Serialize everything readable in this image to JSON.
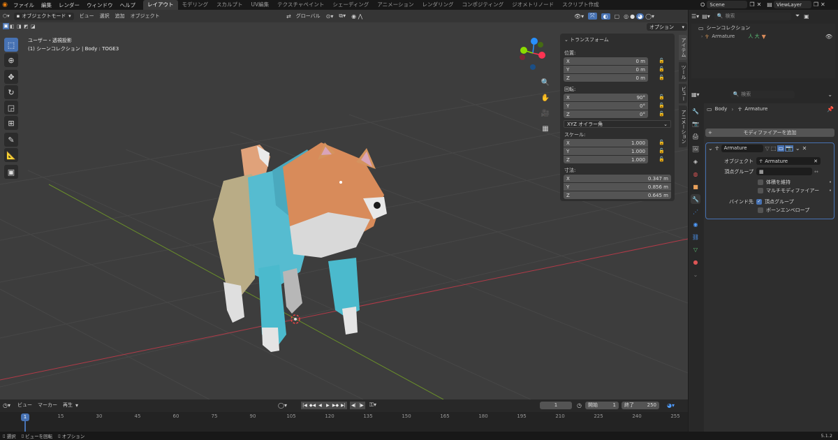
{
  "menu": {
    "items": [
      "ファイル",
      "編集",
      "レンダー",
      "ウィンドウ",
      "ヘルプ"
    ]
  },
  "workspaces": [
    "レイアウト",
    "モデリング",
    "スカルプト",
    "UV編集",
    "テクスチャペイント",
    "シェーディング",
    "アニメーション",
    "レンダリング",
    "コンポジティング",
    "ジオメトリノード",
    "スクリプト作成"
  ],
  "scene": {
    "name": "Scene",
    "viewlayer": "ViewLayer"
  },
  "viewport": {
    "mode": "オブジェクトモード",
    "menus": [
      "ビュー",
      "選択",
      "追加",
      "オブジェクト"
    ],
    "orientation": "グローバル",
    "options": "オプション",
    "view_label": "ユーザー・透視投影",
    "collection_label": "(1) シーンコレクション | Body : TOGE3"
  },
  "npanel": {
    "title": "トランスフォーム",
    "location_label": "位置:",
    "location": [
      {
        "axis": "X",
        "val": "0 m"
      },
      {
        "axis": "Y",
        "val": "0 m"
      },
      {
        "axis": "Z",
        "val": "0 m"
      }
    ],
    "rotation_label": "回転:",
    "rotation": [
      {
        "axis": "X",
        "val": "90°"
      },
      {
        "axis": "Y",
        "val": "0°"
      },
      {
        "axis": "Z",
        "val": "0°"
      }
    ],
    "rotation_mode": "XYZ オイラー角",
    "scale_label": "スケール:",
    "scale": [
      {
        "axis": "X",
        "val": "1.000"
      },
      {
        "axis": "Y",
        "val": "1.000"
      },
      {
        "axis": "Z",
        "val": "1.000"
      }
    ],
    "dim_label": "寸法:",
    "dimensions": [
      {
        "axis": "X",
        "val": "0.347 m"
      },
      {
        "axis": "Y",
        "val": "0.856 m"
      },
      {
        "axis": "Z",
        "val": "0.645 m"
      }
    ],
    "tabs": [
      "アイテム",
      "ツール",
      "ビュー",
      "アニメーション"
    ]
  },
  "outliner": {
    "root": "シーンコレクション",
    "item": "Armature",
    "search_placeholder": "検索"
  },
  "properties": {
    "search_placeholder": "検索",
    "breadcrumb_obj": "Body",
    "breadcrumb_mod": "Armature",
    "add_modifier": "モディファイアーを追加",
    "modifier_name": "Armature",
    "object_label": "オブジェクト",
    "object_value": "Armature",
    "vgroup_label": "頂点グループ",
    "preserve_volume": "体積を維持",
    "multi_modifier": "マルチモディファイアー",
    "bind_to": "バインド先",
    "vertex_groups": "頂点グループ",
    "bone_envelopes": "ボーンエンベロープ"
  },
  "timeline": {
    "menus": [
      "ビュー",
      "マーカー",
      "再生"
    ],
    "current_frame": "1",
    "start_label": "開始",
    "start": "1",
    "end_label": "終了",
    "end": "250",
    "ticks": [
      "1",
      "15",
      "30",
      "45",
      "60",
      "75",
      "90",
      "105",
      "120",
      "135",
      "150",
      "165",
      "180",
      "195",
      "210",
      "225",
      "240",
      "255"
    ],
    "playhead": "1"
  },
  "statusbar": {
    "select": "選択",
    "rotate": "ビューを回転",
    "options": "オプション",
    "version": "5.1.2"
  },
  "colors": {
    "accent": "#4772b3",
    "x_axis": "#ff3352",
    "y_axis": "#8bdc00",
    "z_axis": "#2890ff"
  }
}
